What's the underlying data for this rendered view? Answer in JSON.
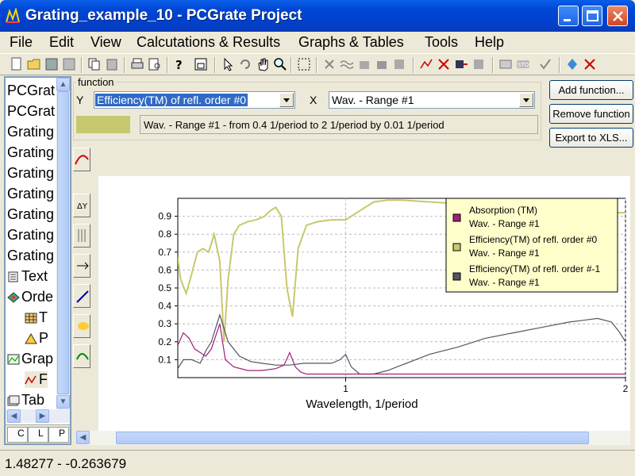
{
  "window": {
    "title": "Grating_example_10 - PCGrate Project"
  },
  "menu": [
    "File",
    "Edit",
    "View",
    "Calcutations & Results",
    "Graphs & Tables",
    "Tools",
    "Help"
  ],
  "tree": {
    "items": [
      {
        "label": "PCGrat",
        "icon": "none"
      },
      {
        "label": "PCGrat",
        "icon": "none"
      },
      {
        "label": "Grating",
        "icon": "none"
      },
      {
        "label": "Grating",
        "icon": "none"
      },
      {
        "label": "Grating",
        "icon": "none"
      },
      {
        "label": "Grating",
        "icon": "none"
      },
      {
        "label": "Grating",
        "icon": "none"
      },
      {
        "label": "Grating",
        "icon": "none"
      },
      {
        "label": "Grating",
        "icon": "none"
      },
      {
        "label": "Text",
        "icon": "text-document-icon"
      },
      {
        "label": "Orde",
        "icon": "orders-icon"
      },
      {
        "label": "T",
        "icon": "table-icon"
      },
      {
        "label": "P",
        "icon": "plot-icon"
      },
      {
        "label": "Grap",
        "icon": "graph-icon"
      },
      {
        "label": "F",
        "icon": "function-graph-icon"
      },
      {
        "label": "Tab",
        "icon": "tables-icon"
      }
    ],
    "tabs": [
      "C",
      "L",
      "P"
    ]
  },
  "function_panel": {
    "group_label": "function",
    "y_label": "Y",
    "y_value": "Efficiency(TM) of refl. order #0",
    "x_label": "X",
    "x_value": "Wav. - Range #1",
    "range_text": "Wav. - Range #1 - from 0.4 1/period to 2 1/period by 0.01 1/period",
    "series_color": "#c8c86e"
  },
  "buttons": {
    "add": "Add function...",
    "remove": "Remove function",
    "export": "Export to XLS..."
  },
  "status": {
    "coords": "1.48277 - -0.263679"
  },
  "chart_data": {
    "type": "line",
    "xlabel": "Wavelength, 1/period",
    "ylabel": "",
    "xlim": [
      0.4,
      2.0
    ],
    "ylim": [
      0.0,
      1.0
    ],
    "x_ticks": [
      "1",
      "2"
    ],
    "y_ticks": [
      "0.1",
      "0.2",
      "0.3",
      "0.4",
      "0.5",
      "0.6",
      "0.7",
      "0.8",
      "0.9"
    ],
    "grid": "dashed",
    "legend_position": "top-right",
    "series": [
      {
        "name": "Absorption (TM)",
        "sub": "Wav. - Range #1",
        "color": "#a0207a",
        "x": [
          0.4,
          0.42,
          0.44,
          0.46,
          0.48,
          0.5,
          0.52,
          0.55,
          0.57,
          0.6,
          0.65,
          0.7,
          0.75,
          0.78,
          0.8,
          0.82,
          0.84,
          0.86,
          0.9,
          0.95,
          1.0,
          1.2,
          1.4,
          1.6,
          1.8,
          2.0
        ],
        "y": [
          0.18,
          0.25,
          0.22,
          0.16,
          0.14,
          0.12,
          0.16,
          0.3,
          0.1,
          0.06,
          0.04,
          0.04,
          0.05,
          0.07,
          0.14,
          0.06,
          0.03,
          0.02,
          0.02,
          0.02,
          0.02,
          0.02,
          0.02,
          0.02,
          0.02,
          0.02
        ]
      },
      {
        "name": "Efficiency(TM) of refl. order #0",
        "sub": "Wav. - Range #1",
        "color": "#c8c86e",
        "x": [
          0.4,
          0.41,
          0.43,
          0.45,
          0.47,
          0.49,
          0.51,
          0.53,
          0.55,
          0.565,
          0.58,
          0.6,
          0.62,
          0.65,
          0.68,
          0.71,
          0.73,
          0.75,
          0.77,
          0.79,
          0.81,
          0.83,
          0.86,
          0.9,
          0.95,
          1.0,
          1.05,
          1.1,
          1.15,
          1.2,
          1.3,
          1.4,
          1.5,
          1.6,
          1.7,
          1.8,
          1.9,
          2.0
        ],
        "y": [
          0.67,
          0.55,
          0.47,
          0.58,
          0.7,
          0.72,
          0.7,
          0.8,
          0.65,
          0.2,
          0.55,
          0.8,
          0.85,
          0.87,
          0.88,
          0.9,
          0.93,
          0.95,
          0.9,
          0.5,
          0.34,
          0.72,
          0.85,
          0.87,
          0.88,
          0.88,
          0.93,
          0.98,
          0.99,
          0.99,
          0.98,
          0.97,
          0.95,
          0.94,
          0.93,
          0.92,
          0.92,
          0.92
        ]
      },
      {
        "name": "Efficiency(TM) of refl. order #-1",
        "sub": "Wav. - Range #1",
        "color": "#555566",
        "x": [
          0.4,
          0.42,
          0.45,
          0.48,
          0.5,
          0.52,
          0.55,
          0.58,
          0.62,
          0.66,
          0.7,
          0.75,
          0.8,
          0.85,
          0.9,
          0.95,
          0.98,
          1.0,
          1.02,
          1.05,
          1.1,
          1.15,
          1.2,
          1.25,
          1.3,
          1.4,
          1.5,
          1.6,
          1.7,
          1.8,
          1.85,
          1.9,
          1.95,
          1.98,
          2.0
        ],
        "y": [
          0.05,
          0.1,
          0.1,
          0.08,
          0.15,
          0.2,
          0.35,
          0.2,
          0.12,
          0.09,
          0.08,
          0.07,
          0.07,
          0.08,
          0.08,
          0.08,
          0.1,
          0.13,
          0.06,
          0.02,
          0.02,
          0.04,
          0.07,
          0.1,
          0.13,
          0.17,
          0.22,
          0.25,
          0.28,
          0.31,
          0.32,
          0.33,
          0.31,
          0.25,
          0.2
        ]
      }
    ]
  }
}
